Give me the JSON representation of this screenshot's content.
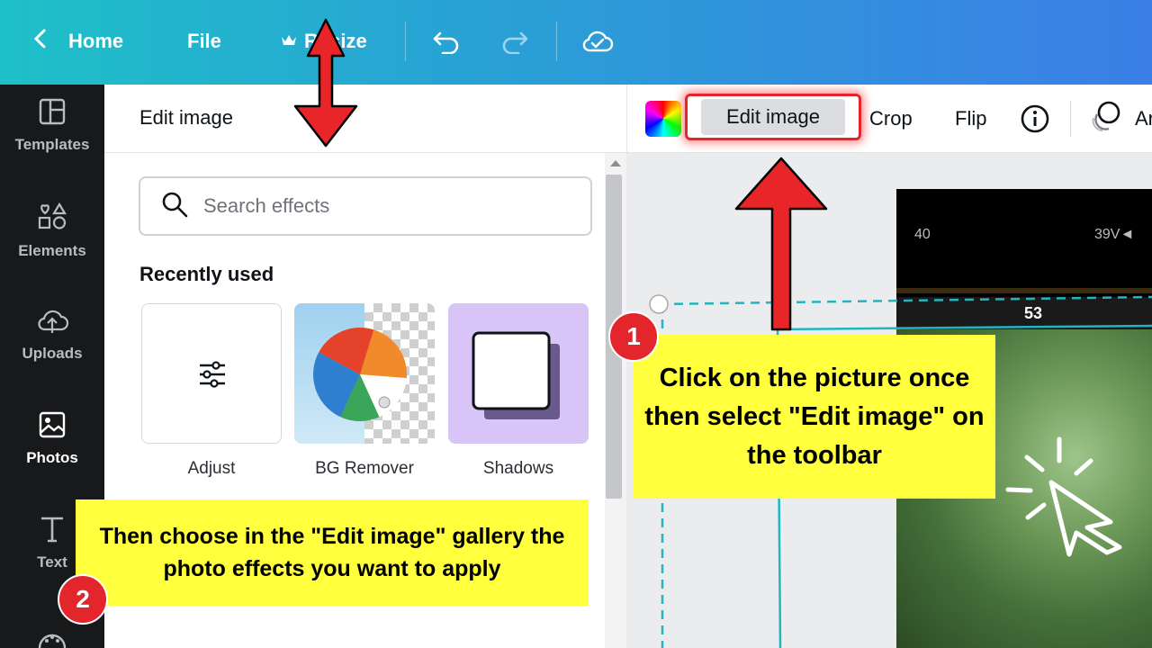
{
  "topbar": {
    "home_label": "Home",
    "file_label": "File",
    "resize_label": "Resize",
    "icons": [
      "chevron-left-icon",
      "crown-icon",
      "undo-icon",
      "redo-icon",
      "cloud-check-icon"
    ]
  },
  "rail": {
    "items": [
      {
        "label": "Templates",
        "icon": "templates-icon",
        "active": false
      },
      {
        "label": "Elements",
        "icon": "elements-icon",
        "active": false
      },
      {
        "label": "Uploads",
        "icon": "cloud-upload-icon",
        "active": false
      },
      {
        "label": "Photos",
        "icon": "photos-icon",
        "active": true
      },
      {
        "label": "Text",
        "icon": "text-icon",
        "active": false
      }
    ]
  },
  "panel": {
    "title": "Edit image",
    "search_placeholder": "Search effects",
    "recent_heading": "Recently used",
    "effects": [
      {
        "label": "Adjust",
        "icon": "sliders-icon"
      },
      {
        "label": "BG Remover",
        "icon": "beach-ball-icon"
      },
      {
        "label": "Shadows",
        "icon": "shadow-square-icon"
      }
    ]
  },
  "toolbar": {
    "edit_image_label": "Edit image",
    "crop_label": "Crop",
    "flip_label": "Flip",
    "info_icon": "info-icon",
    "partial_label": "Ar"
  },
  "photo_overlay": {
    "label_53": "53",
    "label_40": "40",
    "label_39v": "39V◄"
  },
  "annotations": {
    "step1_number": "1",
    "step1_text": "Click on the picture once then select \"Edit image\" on the toolbar",
    "step2_number": "2",
    "step2_text": "Then choose in the \"Edit image\" gallery the photo effects you want to apply"
  },
  "colors": {
    "topbar_start": "#1ec0c8",
    "topbar_end": "#3b7fe6",
    "rail_bg": "#18191b",
    "callout_yellow": "#ffff3d",
    "badge_red": "#e3262c",
    "shadows_card_bg": "#d9c4f7",
    "selection_teal": "#1fb6c1"
  }
}
